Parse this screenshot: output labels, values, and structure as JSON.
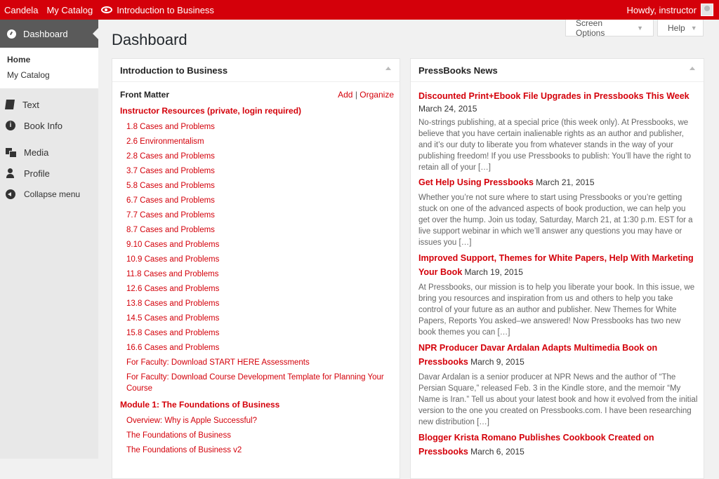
{
  "adminbar": {
    "site1": "Candela",
    "site2": "My Catalog",
    "book": "Introduction to Business",
    "howdy": "Howdy, instructor"
  },
  "sidebar": {
    "dashboard": "Dashboard",
    "sub_home": "Home",
    "sub_catalog": "My Catalog",
    "text": "Text",
    "book_info": "Book Info",
    "media": "Media",
    "profile": "Profile",
    "collapse": "Collapse menu"
  },
  "screen_options": "Screen Options",
  "help": "Help",
  "page_title": "Dashboard",
  "toc": {
    "title": "Introduction to Business",
    "front_matter": "Front Matter",
    "add": "Add",
    "sep": "|",
    "organize": "Organize",
    "part1": "Instructor Resources (private, login required)",
    "part1_chapters": [
      "1.8 Cases and Problems",
      "2.6 Environmentalism",
      "2.8 Cases and Problems",
      "3.7 Cases and Problems",
      "5.8 Cases and Problems",
      "6.7 Cases and Problems",
      "7.7 Cases and Problems",
      "8.7 Cases and Problems",
      "9.10 Cases and Problems",
      "10.9 Cases and Problems",
      "11.8 Cases and Problems",
      "12.6 Cases and Problems",
      "13.8 Cases and Problems",
      "14.5 Cases and Problems",
      "15.8 Cases and Problems",
      "16.6 Cases and Problems",
      "For Faculty: Download START HERE Assessments"
    ],
    "long_chapter": "For Faculty: Download Course Development Template for Planning Your Course",
    "part2": "Module 1: The Foundations of Business",
    "part2_chapters": [
      "Overview: Why is Apple Successful?",
      "The Foundations of Business",
      "The Foundations of Business v2"
    ]
  },
  "news": {
    "title": "PressBooks News",
    "items": [
      {
        "title": "Discounted Print+Ebook File Upgrades in Pressbooks This Week",
        "date": "March 24, 2015",
        "body": "No-strings publishing, at a special price (this week only). At Pressbooks, we believe that you have certain inalienable rights as an author and publisher, and it’s our duty to liberate you from whatever stands in the way of your publishing freedom! If you use Pressbooks to publish: You’ll have the right to retain all of your […]"
      },
      {
        "title": "Get Help Using Pressbooks",
        "date": "March 21, 2015",
        "body": "Whether you’re not sure where to start using Pressbooks or you’re getting stuck on one of the advanced aspects of book production, we can help you get over the hump. Join us today, Saturday, March 21, at 1:30 p.m. EST for a live support webinar in which we’ll answer any questions you may have or issues you […]"
      },
      {
        "title": "Improved Support, Themes for White Papers, Help With Marketing Your Book",
        "date": "March 19, 2015",
        "body": "At Pressbooks, our mission is to help you liberate your book. In this issue, we bring you resources and inspiration from us and others to help you take control of your future as an author and publisher. New Themes for White Papers, Reports You asked–we answered! Now Pressbooks has two new book themes you can […]"
      },
      {
        "title": "NPR Producer Davar Ardalan Adapts Multimedia Book on Pressbooks",
        "date": "March 9, 2015",
        "body": "Davar Ardalan is a senior producer at NPR News and the author of “The Persian Square,”  released Feb. 3 in the Kindle store, and the memoir “My Name is Iran.”  Tell us about your latest book and how it evolved from the initial version to the one you created on Pressbooks.com. I have been researching new distribution […]"
      },
      {
        "title": "Blogger Krista Romano Publishes Cookbook Created on Pressbooks",
        "date": "March 6, 2015",
        "body": ""
      }
    ]
  }
}
